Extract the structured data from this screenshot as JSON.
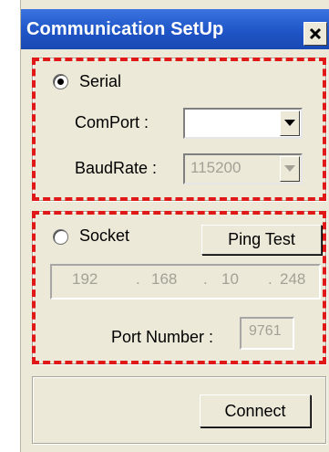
{
  "window": {
    "title": "Communication SetUp",
    "close_icon": "close-icon"
  },
  "serial": {
    "label": "Serial",
    "selected": true,
    "comport_label": "ComPort :",
    "comport_value": "",
    "baudrate_label": "BaudRate :",
    "baudrate_value": "115200"
  },
  "socket": {
    "label": "Socket",
    "selected": false,
    "ping_button": "Ping Test",
    "ip_parts": [
      "192",
      ".",
      "168",
      ".",
      "10",
      ".",
      "248"
    ],
    "port_label": "Port Number :",
    "port_value": "9761"
  },
  "actions": {
    "connect_button": "Connect"
  },
  "colors": {
    "titlebar": "#2a5fc9",
    "dialog_bg": "#ece9d8",
    "highlight": "#e01818"
  }
}
